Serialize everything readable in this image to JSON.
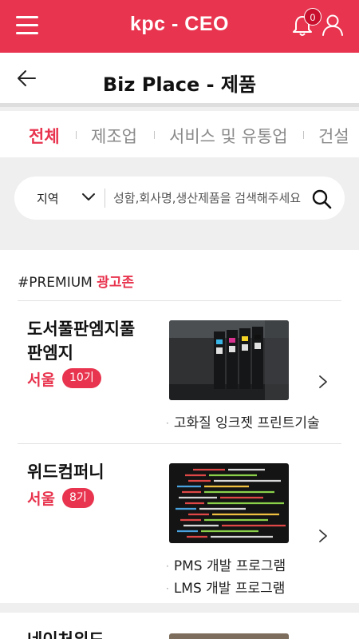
{
  "app": {
    "brand": "kpc - CEO",
    "notification_count": "0"
  },
  "header": {
    "title": "Biz Place - 제품",
    "back_icon": "arrow-left-icon"
  },
  "tabs": [
    {
      "label": "전체",
      "active": true
    },
    {
      "label": "제조업",
      "active": false
    },
    {
      "label": "서비스 및 유통업",
      "active": false
    },
    {
      "label": "건설",
      "active": false
    }
  ],
  "search": {
    "region_label": "지역",
    "placeholder": "성함,회사명,생산제품을 검색해주세요"
  },
  "section": {
    "prefix": "#PREMIUM",
    "accent": "광고존"
  },
  "items": [
    {
      "name": "도서풀판엠지풀판엠지",
      "location": "서울",
      "generation": "10기",
      "image": "printer-ink-cartridges-photo",
      "descriptions": [
        "고화질 잉크젯 프린트기술"
      ]
    },
    {
      "name": "위드컴퍼니",
      "location": "서울",
      "generation": "8기",
      "image": "code-editor-photo",
      "descriptions": [
        "PMS 개발 프로그램",
        "LMS 개발 프로그램"
      ]
    },
    {
      "name": "네이처위드",
      "location": "",
      "generation": "",
      "image": "food-photo",
      "descriptions": []
    }
  ],
  "colors": {
    "accent": "#e8344e",
    "badge": "#c8102e"
  }
}
